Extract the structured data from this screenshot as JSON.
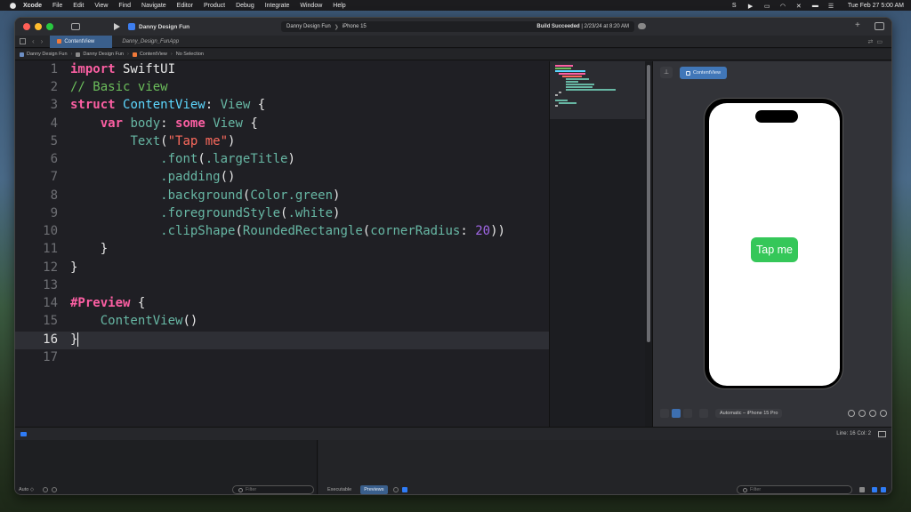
{
  "menubar": {
    "app": "Xcode",
    "items": [
      "File",
      "Edit",
      "View",
      "Find",
      "Navigate",
      "Editor",
      "Product",
      "Debug",
      "Integrate",
      "Window",
      "Help"
    ],
    "clock": "Tue Feb 27  5:00 AM"
  },
  "toolbar": {
    "project": "Danny Design Fun",
    "scheme": "Danny Design Fun",
    "device": "iPhone 15",
    "status_bold": "Build Succeeded",
    "status_time": "2/23/24 at 8:20 AM"
  },
  "tabs": [
    {
      "label": "ContentView",
      "active": true
    },
    {
      "label": "Danny_Design_FunApp",
      "active": false
    }
  ],
  "jumpbar": [
    "Danny Design Fun",
    "Danny Design Fun",
    "ContentView",
    "No Selection"
  ],
  "editor": {
    "current_line": 16,
    "line_numbers": [
      "1",
      "2",
      "3",
      "4",
      "5",
      "6",
      "7",
      "8",
      "9",
      "10",
      "11",
      "12",
      "13",
      "14",
      "15",
      "16",
      "17"
    ],
    "code": [
      "import SwiftUI",
      "// Basic view",
      "struct ContentView: View {",
      "    var body: some View {",
      "        Text(\"Tap me\")",
      "            .font(.largeTitle)",
      "            .padding()",
      "            .background(Color.green)",
      "            .foregroundStyle(.white)",
      "            .clipShape(RoundedRectangle(cornerRadius: 20))",
      "    }",
      "}",
      "",
      "#Preview {",
      "    ContentView()",
      "}",
      ""
    ]
  },
  "preview": {
    "tab_label": "ContentView",
    "button_text": "Tap me",
    "device_selector": "Automatic – iPhone 15 Pro",
    "button_color": "#35c759"
  },
  "statusbar": {
    "position": "Line: 16  Col: 2"
  },
  "debug": {
    "auto_label": "Auto ◇",
    "filter_placeholder": "Filter",
    "executable_label": "Executable",
    "previews_label": "Previews"
  }
}
